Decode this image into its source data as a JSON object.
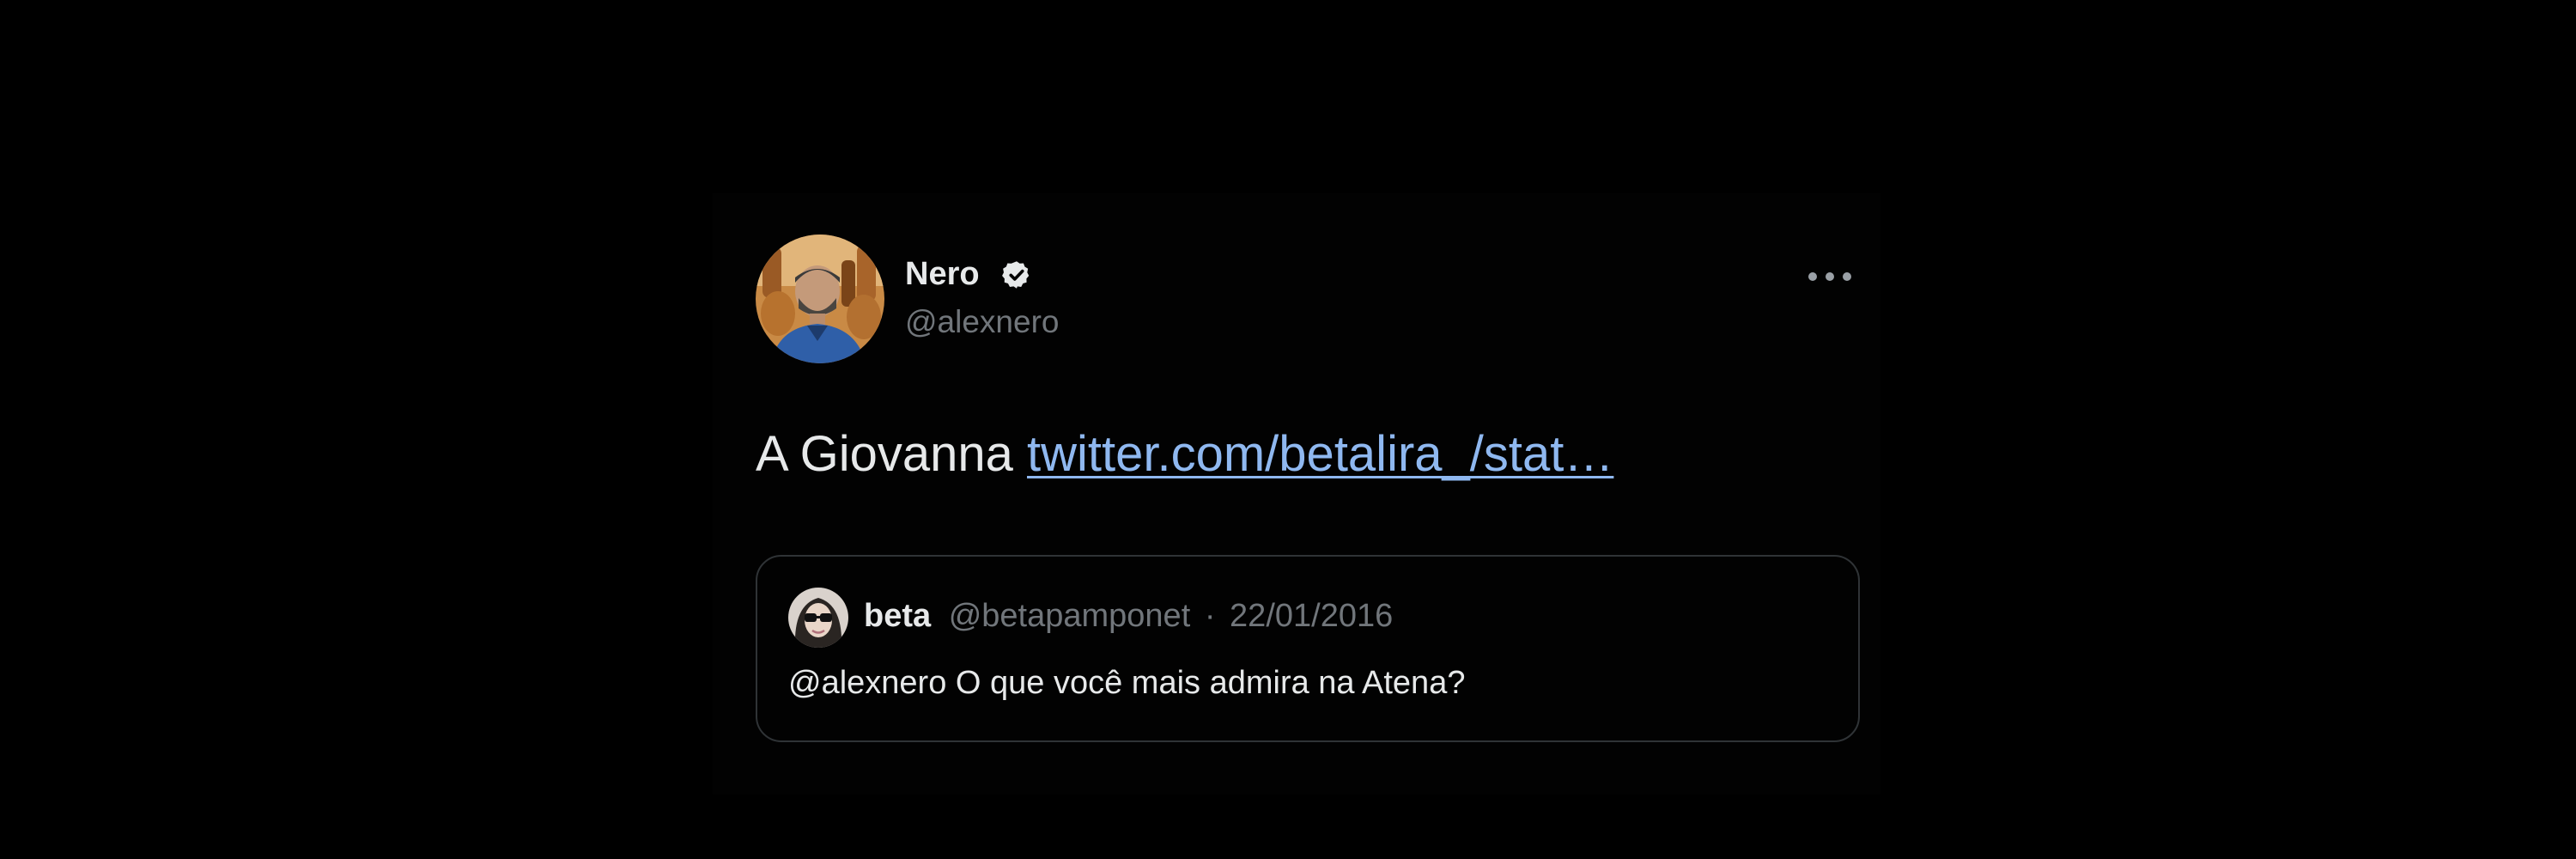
{
  "tweet": {
    "author": {
      "display_name": "Nero",
      "handle": "@alexnero",
      "verified": true
    },
    "text_prefix": "A Giovanna",
    "link_text": "twitter.com/betalira_/stat…",
    "more_icon": "more-horizontal-icon",
    "verified_icon": "verified-badge-icon"
  },
  "quoted_tweet": {
    "author": {
      "display_name": "beta",
      "handle": "@betapamponet"
    },
    "separator": "·",
    "date": "22/01/2016",
    "text": "@alexnero O que você mais admira na Atena?"
  },
  "colors": {
    "background": "#000000",
    "text_primary": "#e7e9ea",
    "text_secondary": "#71767b",
    "link": "#8fb8f0",
    "border": "#2f3336"
  }
}
